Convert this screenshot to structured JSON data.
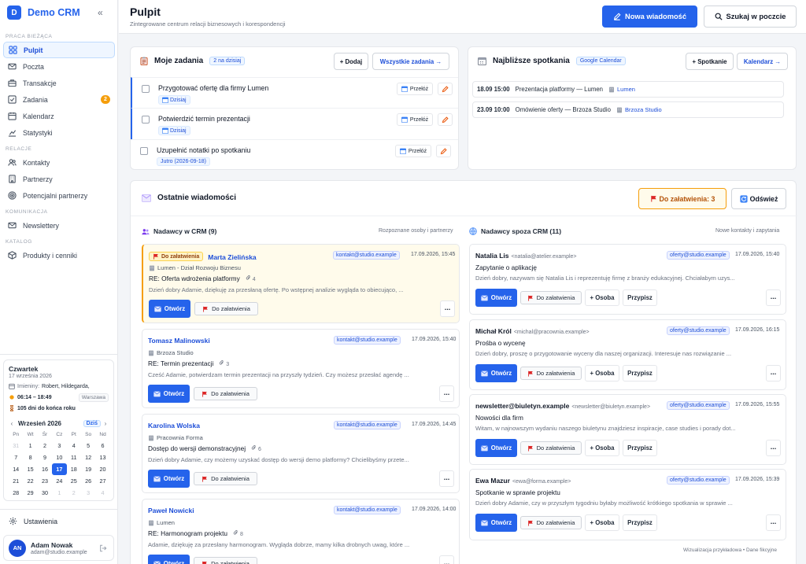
{
  "sidebar": {
    "logo_letter": "D",
    "brand": "Demo CRM",
    "collapse_glyph": "«",
    "sections": {
      "work": "Praca bieżąca",
      "relations": "Relacje",
      "communication": "Komunikacja",
      "catalog": "Katalog"
    },
    "items": {
      "pulpit": "Pulpit",
      "poczta": "Poczta",
      "transakcje": "Transakcje",
      "zadania": "Zadania",
      "zadania_badge": "2",
      "kalendarz": "Kalendarz",
      "statystyki": "Statystyki",
      "kontakty": "Kontakty",
      "partnerzy": "Partnerzy",
      "potencjalni": "Potencjalni partnerzy",
      "newslettery": "Newslettery",
      "produkty": "Produkty i cenniki"
    },
    "day": {
      "weekday": "Czwartek",
      "date": "17 września 2026",
      "namedays_label": "Imieniny:",
      "namedays": "Robert, Hildegarda,",
      "sun": "06:14 – 18:49",
      "city": "Warszawa",
      "year_left": "105 dni do końca roku"
    },
    "calendar": {
      "month": "Wrzesień 2026",
      "prev": "‹",
      "next": "›",
      "today": "Dziś",
      "dow": [
        "Pn",
        "Wt",
        "Śr",
        "Cz",
        "Pt",
        "So",
        "Nd"
      ],
      "days": [
        [
          "31",
          "1",
          "2",
          "3",
          "4",
          "5",
          "6"
        ],
        [
          "7",
          "8",
          "9",
          "10",
          "11",
          "12",
          "13"
        ],
        [
          "14",
          "15",
          "16",
          "17",
          "18",
          "19",
          "20"
        ],
        [
          "21",
          "22",
          "23",
          "24",
          "25",
          "26",
          "27"
        ],
        [
          "28",
          "29",
          "30",
          "1",
          "2",
          "3",
          "4"
        ]
      ],
      "selected": "17"
    },
    "settings": "Ustawienia",
    "user": {
      "initials": "AN",
      "name": "Adam Nowak",
      "email": "adam@studio.example"
    }
  },
  "header": {
    "title": "Pulpit",
    "subtitle": "Zintegrowane centrum relacji biznesowych i korespondencji",
    "new_message": "Nowa wiadomość",
    "search_mail": "Szukaj w poczcie"
  },
  "tasks": {
    "title": "Moje zadania",
    "count": "2 na dzisiaj",
    "add": "+ Dodaj",
    "all": "Wszystkie zadania →",
    "reschedule": "Przełóż",
    "items": [
      {
        "title": "Przygotować ofertę dla firmy Lumen",
        "tag": "Dzisiaj"
      },
      {
        "title": "Potwierdzić termin prezentacji",
        "tag": "Dzisiaj"
      },
      {
        "title": "Uzupełnić notatki po spotkaniu",
        "tag": "Jutro (2026-09-18)"
      }
    ]
  },
  "meetings": {
    "title": "Najbliższe spotkania",
    "source": "Google Calendar",
    "add": "+ Spotkanie",
    "calendar": "Kalendarz →",
    "items": [
      {
        "time": "18.09 15:00",
        "title": "Prezentacja platformy — Lumen",
        "company": "Lumen"
      },
      {
        "time": "23.09 10:00",
        "title": "Omówienie oferty — Brzoza Studio",
        "company": "Brzoza Studio"
      }
    ]
  },
  "messages": {
    "title": "Ostatnie wiadomości",
    "pending": "Do załatwienia: 3",
    "refresh": "Odśwież",
    "labels": {
      "open": "Otwórz",
      "todo": "Do załatwienia",
      "person": "+ Osoba",
      "assign": "Przypisz",
      "more": "..."
    },
    "crm": {
      "title": "Nadawcy w CRM (9)",
      "note": "Rozpoznane osoby i partnerzy",
      "items": [
        {
          "tag": "Do załatwienia",
          "name": "Marta Zielińska",
          "org": "Lumen - Dział Rozwoju Biznesu",
          "box": "kontakt@studio.example",
          "date": "17.09.2026, 15:45",
          "subject": "RE: Oferta wdrożenia platformy",
          "att": "4",
          "preview": "Dzień dobry Adamie, dziękuję za przesłaną ofertę. Po wstępnej analizie wygląda to obiecująco, ..."
        },
        {
          "name": "Tomasz Malinowski",
          "org": "Brzoza Studio",
          "box": "kontakt@studio.example",
          "date": "17.09.2026, 15:40",
          "subject": "RE: Termin prezentacji",
          "att": "3",
          "preview": "Cześć Adamie, potwierdzam termin prezentacji na przyszły tydzień. Czy możesz przesłać agendę ..."
        },
        {
          "name": "Karolina Wolska",
          "org": "Pracownia Forma",
          "box": "kontakt@studio.example",
          "date": "17.09.2026, 14:45",
          "subject": "Dostęp do wersji demonstracyjnej",
          "att": "6",
          "preview": "Dzień dobry Adamie, czy możemy uzyskać dostęp do wersji demo platformy? Chcielibyśmy przete..."
        },
        {
          "name": "Paweł Nowicki",
          "org": "Lumen",
          "box": "kontakt@studio.example",
          "date": "17.09.2026, 14:00",
          "subject": "RE: Harmonogram projektu",
          "att": "8",
          "preview": "Adamie, dziękuję za przesłany harmonogram. Wygląda dobrze, mamy kilka drobnych uwag, które ..."
        }
      ]
    },
    "external": {
      "title": "Nadawcy spoza CRM (11)",
      "note": "Nowe kontakty i zapytania",
      "items": [
        {
          "name": "Natalia Lis",
          "addr": "<natalia@atelier.example>",
          "box": "oferty@studio.example",
          "date": "17.09.2026, 15:40",
          "subject": "Zapytanie o aplikację",
          "preview": "Dzień dobry, nazywam się Natalia Lis i reprezentuję firmę z branży edukacyjnej. Chciałabym uzys..."
        },
        {
          "name": "Michał Król",
          "addr": "<michal@pracownia.example>",
          "box": "oferty@studio.example",
          "date": "17.09.2026, 16:15",
          "subject": "Prośba o wycenę",
          "preview": "Dzień dobry, proszę o przygotowanie wyceny dla naszej organizacji. Interesuje nas rozwiązanie ..."
        },
        {
          "name": "newsletter@biuletyn.example",
          "addr": "<newsletter@biuletyn.example>",
          "box": "oferty@studio.example",
          "date": "17.09.2026, 15:55",
          "subject": "Nowości dla firm",
          "preview": "Witam, w najnowszym wydaniu naszego biuletynu znajdziesz inspiracje, case studies i porady dot..."
        },
        {
          "name": "Ewa Mazur",
          "addr": "<ewa@forma.example>",
          "box": "oferty@studio.example",
          "date": "17.09.2026, 15:39",
          "subject": "Spotkanie w sprawie projektu",
          "preview": "Dzień dobry Adamie, czy w przyszłym tygodniu byłaby możliwość krótkiego spotkania w sprawie ..."
        }
      ]
    }
  },
  "footnote": "Wizualizacja przykładowa • Dane fikcyjne",
  "colors": {
    "accent": "#2563eb",
    "warning": "#f59e0b",
    "flag": "#dc2626"
  }
}
